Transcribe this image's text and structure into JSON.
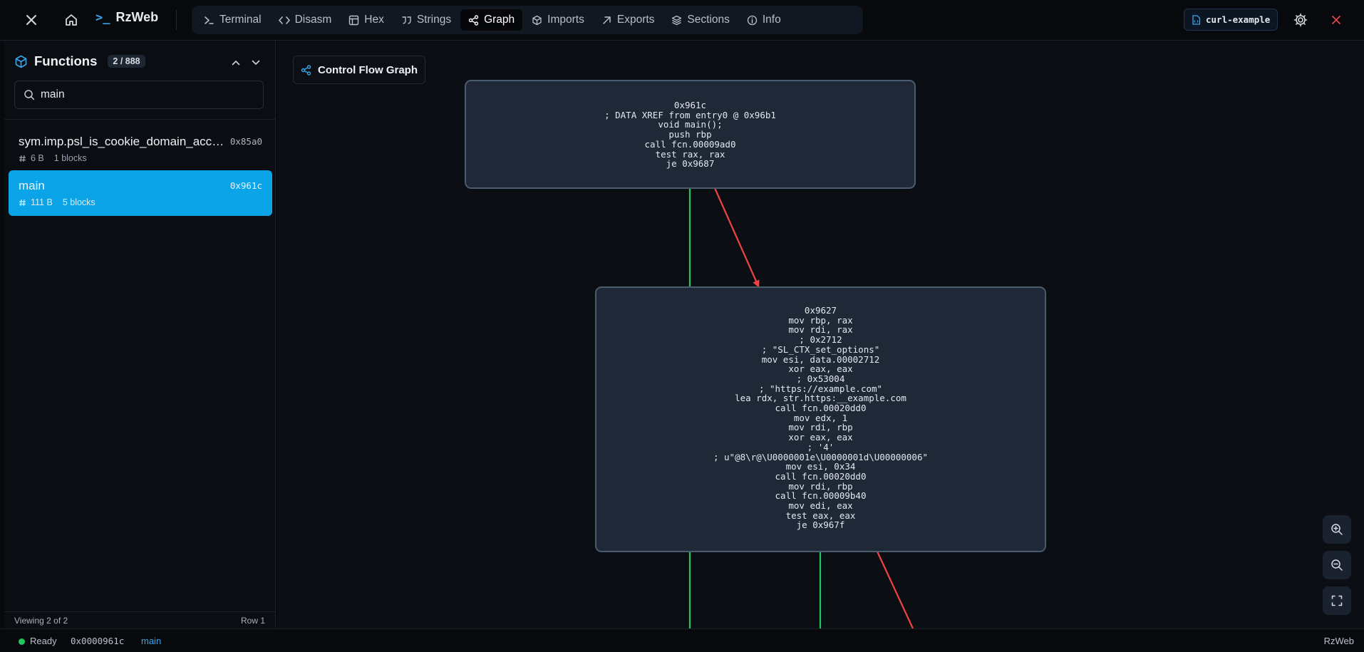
{
  "header": {
    "brand_prompt": ">_",
    "brand": "RzWeb",
    "tabs": [
      {
        "label": "Terminal",
        "icon": "terminal-icon"
      },
      {
        "label": "Disasm",
        "icon": "code-icon"
      },
      {
        "label": "Hex",
        "icon": "table-icon"
      },
      {
        "label": "Strings",
        "icon": "quote-icon"
      },
      {
        "label": "Graph",
        "icon": "share-icon",
        "active": true
      },
      {
        "label": "Imports",
        "icon": "package-icon"
      },
      {
        "label": "Exports",
        "icon": "arrow-up-right-icon"
      },
      {
        "label": "Sections",
        "icon": "layers-icon"
      },
      {
        "label": "Info",
        "icon": "info-icon"
      }
    ],
    "file_name": "curl-example"
  },
  "sidebar": {
    "title": "Functions",
    "count": "2 / 888",
    "search_value": "main",
    "functions": [
      {
        "name": "sym.imp.psl_is_cookie_domain_acceptable",
        "addr": "0x85a0",
        "size": "6 B",
        "blocks": "1 blocks"
      },
      {
        "name": "main",
        "addr": "0x961c",
        "size": "111 B",
        "blocks": "5 blocks",
        "selected": true
      }
    ],
    "footer_left": "Viewing 2 of 2",
    "footer_right": "Row 1"
  },
  "graph": {
    "title": "Control Flow Graph",
    "nodes": [
      {
        "id": "0x961c",
        "lines": [
          "0x961c",
          "; DATA XREF from entry0 @ 0x96b1",
          "void main();",
          "push rbp",
          "call fcn.00009ad0",
          "test rax, rax",
          "je 0x9687"
        ]
      },
      {
        "id": "0x9627",
        "lines": [
          "0x9627",
          "mov rbp, rax",
          "mov rdi, rax",
          "; 0x2712",
          "; \"SL_CTX_set_options\"",
          "mov esi, data.00002712",
          "xor eax, eax",
          "; 0x53004",
          "; \"https://example.com\"",
          "lea rdx, str.https:__example.com",
          "call fcn.00020dd0",
          "mov edx, 1",
          "mov rdi, rbp",
          "xor eax, eax",
          "; '4'",
          "; u\"@8\\r@\\U0000001e\\U0000001d\\U00000006\"",
          "mov esi, 0x34",
          "call fcn.00020dd0",
          "mov rdi, rbp",
          "call fcn.00009b40",
          "mov edi, eax",
          "test eax, eax",
          "je 0x967f"
        ]
      }
    ],
    "edge_colors": {
      "true": "#22c55e",
      "false": "#ef4444"
    }
  },
  "status": {
    "state": "Ready",
    "address": "0x0000961c",
    "function": "main",
    "brand": "RzWeb"
  }
}
